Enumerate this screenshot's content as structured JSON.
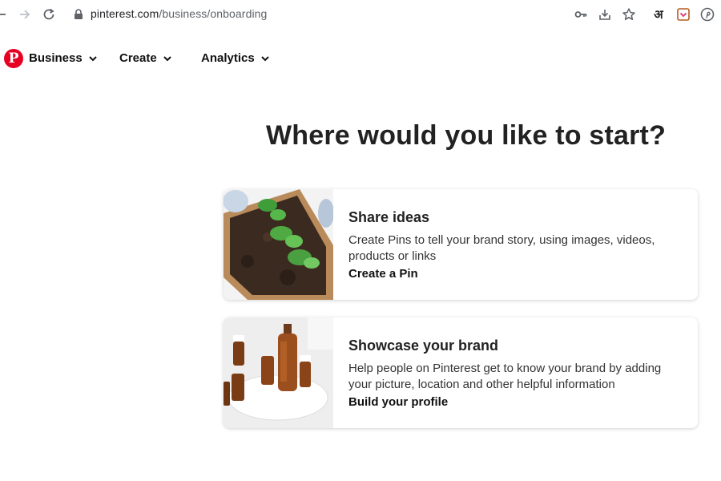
{
  "browser": {
    "url_domain": "pinterest.com",
    "url_path": "/business/onboarding",
    "extension_label": "अ"
  },
  "header": {
    "logo_letter": "P",
    "nav": [
      {
        "label": "Business"
      },
      {
        "label": "Create"
      },
      {
        "label": "Analytics"
      }
    ]
  },
  "main": {
    "title": "Where would you like to start?",
    "cards": [
      {
        "title": "Share ideas",
        "description": "Create Pins to tell your brand story, using images, videos, products or links",
        "link": "Create a Pin",
        "image_icon": "garden-seedlings-image"
      },
      {
        "title": "Showcase your brand",
        "description": "Help people on Pinterest get to know your brand by adding your picture, location and other helpful information",
        "link": "Build your profile",
        "image_icon": "amber-bottles-image"
      }
    ]
  },
  "colors": {
    "brand": "#e60023",
    "text": "#111111",
    "url_gray": "#5f6368"
  }
}
